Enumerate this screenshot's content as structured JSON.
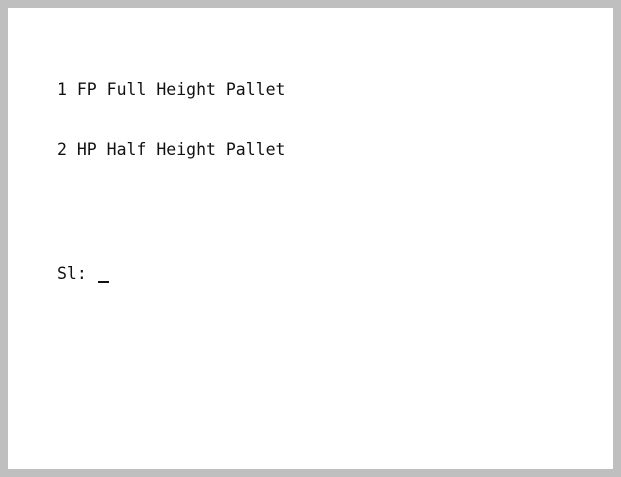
{
  "menu": {
    "items": [
      {
        "number": "1",
        "code": "FP",
        "label": "Full Height Pallet",
        "text": "1 FP Full Height Pallet"
      },
      {
        "number": "2",
        "code": "HP",
        "label": "Half Height Pallet",
        "text": "2 HP Half Height Pallet"
      }
    ]
  },
  "prompt": {
    "label": "Sl: ",
    "value": ""
  }
}
